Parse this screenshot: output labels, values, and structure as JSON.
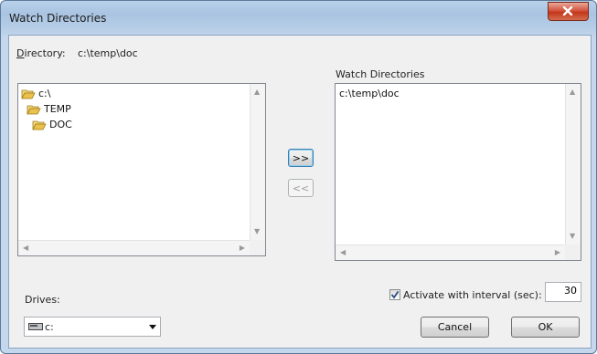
{
  "window": {
    "title": "Watch Directories"
  },
  "directory": {
    "label_first": "D",
    "label_rest": "irectory:",
    "value": "c:\\temp\\doc"
  },
  "tree": {
    "items": [
      {
        "label": "c:\\",
        "icon": "open-folder-icon"
      },
      {
        "label": "TEMP",
        "icon": "open-folder-icon"
      },
      {
        "label": "DOC",
        "icon": "open-folder-icon"
      }
    ]
  },
  "watch": {
    "heading": "Watch Directories",
    "items": [
      "c:\\temp\\doc"
    ]
  },
  "buttons": {
    "add": ">>",
    "remove": "<<",
    "cancel": "Cancel",
    "ok": "OK"
  },
  "drives": {
    "label": "Drives:",
    "selected": "c:"
  },
  "interval": {
    "label": "Activate with interval (sec):",
    "value": "30",
    "checked": true
  },
  "colors": {
    "folder": "#e8c24a",
    "check_mark": "#2a4e7e",
    "selection_border": "#3c7fb1"
  }
}
